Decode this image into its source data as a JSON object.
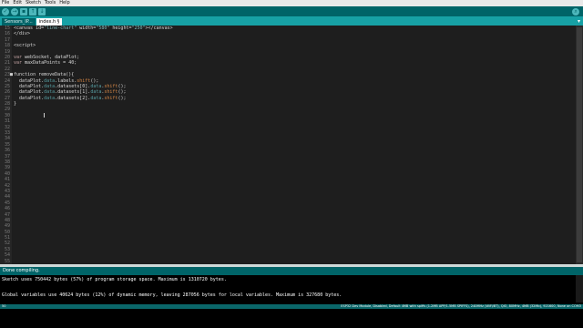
{
  "menu": [
    "File",
    "Edit",
    "Sketch",
    "Tools",
    "Help"
  ],
  "toolbar": {
    "buttons": [
      {
        "name": "verify-button",
        "icon": "check-icon",
        "glyph": "✓"
      },
      {
        "name": "upload-button",
        "icon": "arrow-right-icon",
        "glyph": "→"
      },
      {
        "name": "new-button",
        "icon": "new-file-icon",
        "glyph": "▪"
      },
      {
        "name": "open-button",
        "icon": "open-arrow-up-icon",
        "glyph": "↑"
      },
      {
        "name": "save-button",
        "icon": "save-arrow-down-icon",
        "glyph": "↓"
      }
    ],
    "serial_monitor_glyph": "⌕"
  },
  "tabs": [
    "Sensors_IP...",
    "index.h §"
  ],
  "tab_menu_glyph": "▾",
  "editor": {
    "lines": [
      {
        "n": "15",
        "fold": "",
        "parts": [
          [
            "<canvas id=",
            "t"
          ],
          [
            "\"line-chart\"",
            "str"
          ],
          [
            " width=",
            "t"
          ],
          [
            "\"580\"",
            "str"
          ],
          [
            " height=",
            "t"
          ],
          [
            "\"250\"",
            "str"
          ],
          [
            "></canvas>",
            "t"
          ]
        ]
      },
      {
        "n": "16",
        "fold": "",
        "parts": [
          [
            "</div>",
            "t"
          ]
        ]
      },
      {
        "n": "17",
        "fold": "",
        "parts": []
      },
      {
        "n": "18",
        "fold": "",
        "parts": [
          [
            "<script>",
            "t"
          ]
        ]
      },
      {
        "n": "19",
        "fold": "",
        "parts": []
      },
      {
        "n": "20",
        "fold": "",
        "parts": [
          [
            "var",
            "kw"
          ],
          [
            " webSocket, dataPlot;",
            "t"
          ]
        ]
      },
      {
        "n": "21",
        "fold": "",
        "parts": [
          [
            "var",
            "kw"
          ],
          [
            " maxDataPoints = 40;",
            "t"
          ]
        ]
      },
      {
        "n": "22",
        "fold": "",
        "parts": []
      },
      {
        "n": "23",
        "fold": "■",
        "parts": [
          [
            "function",
            "t"
          ],
          [
            " removeData(){",
            "t"
          ]
        ]
      },
      {
        "n": "24",
        "fold": "",
        "parts": [
          [
            "  dataPlot.",
            "t"
          ],
          [
            "data",
            "prop"
          ],
          [
            ".labels.",
            "t"
          ],
          [
            "shift",
            "fn"
          ],
          [
            "();",
            "t"
          ]
        ]
      },
      {
        "n": "25",
        "fold": "",
        "parts": [
          [
            "  dataPlot.",
            "t"
          ],
          [
            "data",
            "prop"
          ],
          [
            ".datasets[0].",
            "t"
          ],
          [
            "data",
            "prop"
          ],
          [
            ".",
            "t"
          ],
          [
            "shift",
            "fn"
          ],
          [
            "();",
            "t"
          ]
        ]
      },
      {
        "n": "26",
        "fold": "",
        "parts": [
          [
            "  dataPlot.",
            "t"
          ],
          [
            "data",
            "prop"
          ],
          [
            ".datasets[1].",
            "t"
          ],
          [
            "data",
            "prop"
          ],
          [
            ".",
            "t"
          ],
          [
            "shift",
            "fn"
          ],
          [
            "();",
            "t"
          ]
        ]
      },
      {
        "n": "27",
        "fold": "",
        "parts": [
          [
            "  dataPlot.",
            "t"
          ],
          [
            "data",
            "prop"
          ],
          [
            ".datasets[2].",
            "t"
          ],
          [
            "data",
            "prop"
          ],
          [
            ".",
            "t"
          ],
          [
            "shift",
            "fn"
          ],
          [
            "();",
            "t"
          ]
        ]
      },
      {
        "n": "28",
        "fold": "",
        "parts": [
          [
            "}",
            "t"
          ]
        ]
      },
      {
        "n": "29",
        "fold": "",
        "parts": []
      },
      {
        "n": "30",
        "fold": "",
        "parts": []
      },
      {
        "n": "31",
        "fold": "",
        "parts": []
      },
      {
        "n": "32",
        "fold": "",
        "parts": []
      },
      {
        "n": "33",
        "fold": "",
        "parts": []
      },
      {
        "n": "34",
        "fold": "",
        "parts": []
      },
      {
        "n": "35",
        "fold": "",
        "parts": []
      },
      {
        "n": "36",
        "fold": "",
        "parts": []
      },
      {
        "n": "37",
        "fold": "",
        "parts": []
      },
      {
        "n": "38",
        "fold": "",
        "parts": []
      },
      {
        "n": "39",
        "fold": "",
        "parts": []
      },
      {
        "n": "40",
        "fold": "",
        "parts": []
      },
      {
        "n": "41",
        "fold": "",
        "parts": []
      },
      {
        "n": "42",
        "fold": "",
        "parts": []
      },
      {
        "n": "43",
        "fold": "",
        "parts": []
      },
      {
        "n": "44",
        "fold": "",
        "parts": []
      },
      {
        "n": "45",
        "fold": "",
        "parts": []
      },
      {
        "n": "46",
        "fold": "",
        "parts": []
      },
      {
        "n": "47",
        "fold": "",
        "parts": []
      },
      {
        "n": "48",
        "fold": "",
        "parts": []
      },
      {
        "n": "49",
        "fold": "",
        "parts": []
      },
      {
        "n": "50",
        "fold": "",
        "parts": []
      },
      {
        "n": "51",
        "fold": "",
        "parts": []
      },
      {
        "n": "52",
        "fold": "",
        "parts": []
      },
      {
        "n": "53",
        "fold": "",
        "parts": []
      },
      {
        "n": "54",
        "fold": "",
        "parts": []
      },
      {
        "n": "55",
        "fold": "",
        "parts": []
      }
    ]
  },
  "status": {
    "text": "Done compiling."
  },
  "console": {
    "lines": [
      "Sketch uses 750442 bytes (57%) of program storage space. Maximum is 1310720 bytes.",
      "Global variables use 40624 bytes (12%) of dynamic memory, leaving 287056 bytes for local variables. Maximum is 327680 bytes."
    ]
  },
  "bottom": {
    "line_number": "50",
    "board": "ESP32 Dev Module, Disabled, Default 4MB with spiffs (1.2MB APP/1.5MB SPIFFS), 240MHz (WiFi/BT), QIO, 80MHz, 4MB (32Mb), 921600, None on COM3"
  },
  "colors": {
    "toolbar": "#006468",
    "tabbar": "#17a1a5",
    "editor_bg": "#1e1e1e",
    "console_bg": "#000000"
  }
}
